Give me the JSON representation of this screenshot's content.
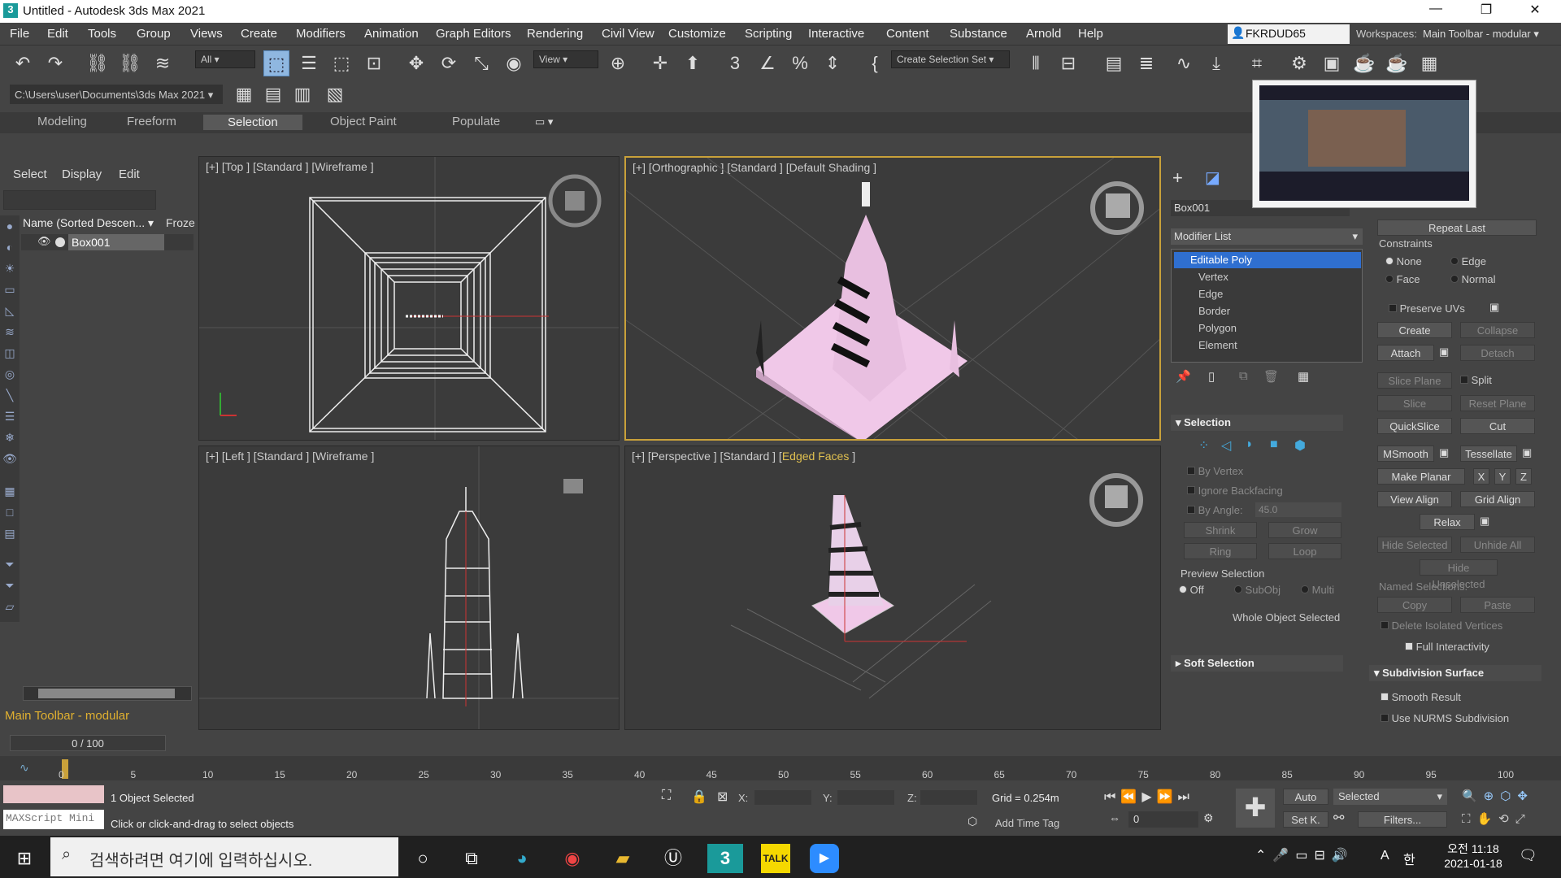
{
  "title": "Untitled - Autodesk 3ds Max 2021",
  "menu": [
    "File",
    "Edit",
    "Tools",
    "Group",
    "Views",
    "Create",
    "Modifiers",
    "Animation",
    "Graph Editors",
    "Rendering",
    "Civil View",
    "Customize",
    "Scripting",
    "Interactive",
    "Content",
    "Substance",
    "Arnold",
    "Help"
  ],
  "user": "FKRDUD65",
  "workspaces_label": "Workspaces:",
  "workspace_value": "Main Toolbar - modular",
  "toolbar": {
    "filter": "All",
    "refcoord": "View",
    "selset": "Create Selection Set"
  },
  "path": "C:\\Users\\user\\Documents\\3ds Max 2021",
  "ribbon": [
    "Modeling",
    "Freeform",
    "Selection",
    "Object Paint",
    "Populate"
  ],
  "scene": {
    "tabs": [
      "Select",
      "Display",
      "Edit"
    ],
    "col_name": "Name (Sorted Descen...",
    "col_froze": "Froze",
    "item": "Box001",
    "toolbar_label": "Main Toolbar - modular",
    "frame": "0 / 100"
  },
  "viewports": {
    "top": "[+] [Top ] [Standard ] [Wireframe ]",
    "ortho": "[+] [Orthographic ] [Standard ] [Default Shading ]",
    "left": "[+] [Left ] [Standard ] [Wireframe ]",
    "persp_prefix": "[+] [Perspective ] [Standard ] [",
    "persp_mode": "Edged Faces",
    "persp_suffix": " ]"
  },
  "cmd": {
    "object_name": "Box001",
    "modifier_list": "Modifier List",
    "stack": [
      "Editable Poly",
      "Vertex",
      "Edge",
      "Border",
      "Polygon",
      "Element"
    ],
    "selection_title": "Selection",
    "by_vertex": "By Vertex",
    "ignore_backfacing": "Ignore Backfacing",
    "by_angle": "By Angle:",
    "angle_value": "45.0",
    "shrink": "Shrink",
    "grow": "Grow",
    "ring": "Ring",
    "loop": "Loop",
    "preview_selection": "Preview Selection",
    "preview_opts": [
      "Off",
      "SubObj",
      "Multi"
    ],
    "whole_object": "Whole Object Selected",
    "soft_selection": "Soft Selection"
  },
  "right": {
    "repeat_last": "Repeat Last",
    "constraints": "Constraints",
    "c_none": "None",
    "c_edge": "Edge",
    "c_face": "Face",
    "c_normal": "Normal",
    "preserve_uvs": "Preserve UVs",
    "create": "Create",
    "collapse": "Collapse",
    "attach": "Attach",
    "detach": "Detach",
    "slice_plane": "Slice Plane",
    "split": "Split",
    "slice": "Slice",
    "reset_plane": "Reset Plane",
    "quickslice": "QuickSlice",
    "cut": "Cut",
    "msmooth": "MSmooth",
    "tessellate": "Tessellate",
    "make_planar": "Make Planar",
    "x": "X",
    "y": "Y",
    "z": "Z",
    "view_align": "View Align",
    "grid_align": "Grid Align",
    "relax": "Relax",
    "hide_selected": "Hide Selected",
    "unhide_all": "Unhide All",
    "hide_unselected": "Hide Unselected",
    "named_selections": "Named Selections:",
    "copy": "Copy",
    "paste": "Paste",
    "delete_isolated": "Delete Isolated Vertices",
    "full_interactivity": "Full Interactivity",
    "subdiv_title": "Subdivision Surface",
    "smooth_result": "Smooth Result",
    "use_nurms": "Use NURMS Subdivision"
  },
  "timeline_ticks": [
    "0",
    "5",
    "10",
    "15",
    "20",
    "25",
    "30",
    "35",
    "40",
    "45",
    "50",
    "55",
    "60",
    "65",
    "70",
    "75",
    "80",
    "85",
    "90",
    "95",
    "100"
  ],
  "status": {
    "maxscript": "MAXScript Mini",
    "objects": "1 Object Selected",
    "prompt": "Click or click-and-drag to select objects",
    "x": "X:",
    "y": "Y:",
    "z": "Z:",
    "grid": "Grid = 0.254m",
    "add_time_tag": "Add Time Tag",
    "auto": "Auto",
    "setk": "Set K.",
    "selected": "Selected",
    "filters": "Filters...",
    "frame_field": "0"
  },
  "taskbar": {
    "search": "검색하려면 여기에 입력하십시오.",
    "time": "오전 11:18",
    "date": "2021-01-18",
    "lang": "A",
    "ime": "한"
  },
  "colors": {
    "active_border": "#c9a13a",
    "selected_stack": "#2f6fd0",
    "object_pink": "#f0c8e8"
  }
}
